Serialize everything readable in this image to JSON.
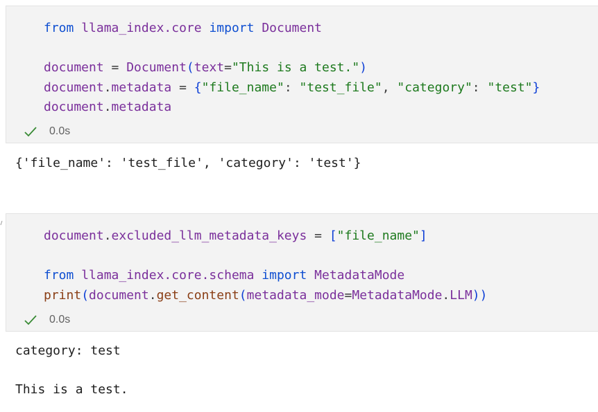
{
  "cells": [
    {
      "code_lines": [
        [
          {
            "t": "from",
            "c": "kw"
          },
          {
            "t": " ",
            "c": "plain"
          },
          {
            "t": "llama_index.core",
            "c": "var"
          },
          {
            "t": " ",
            "c": "plain"
          },
          {
            "t": "import",
            "c": "kw"
          },
          {
            "t": " ",
            "c": "plain"
          },
          {
            "t": "Document",
            "c": "var"
          }
        ],
        [],
        [
          {
            "t": "document",
            "c": "var"
          },
          {
            "t": " = ",
            "c": "plain"
          },
          {
            "t": "Document",
            "c": "var"
          },
          {
            "t": "(",
            "c": "br1"
          },
          {
            "t": "text",
            "c": "var"
          },
          {
            "t": "=",
            "c": "plain"
          },
          {
            "t": "\"This is a test.\"",
            "c": "str"
          },
          {
            "t": ")",
            "c": "br1"
          }
        ],
        [
          {
            "t": "document",
            "c": "var"
          },
          {
            "t": ".",
            "c": "plain"
          },
          {
            "t": "metadata",
            "c": "var"
          },
          {
            "t": " = ",
            "c": "plain"
          },
          {
            "t": "{",
            "c": "br1"
          },
          {
            "t": "\"file_name\"",
            "c": "str"
          },
          {
            "t": ": ",
            "c": "plain"
          },
          {
            "t": "\"test_file\"",
            "c": "str"
          },
          {
            "t": ", ",
            "c": "plain"
          },
          {
            "t": "\"category\"",
            "c": "str"
          },
          {
            "t": ": ",
            "c": "plain"
          },
          {
            "t": "\"test\"",
            "c": "str"
          },
          {
            "t": "}",
            "c": "br1"
          }
        ],
        [
          {
            "t": "document",
            "c": "var"
          },
          {
            "t": ".",
            "c": "plain"
          },
          {
            "t": "metadata",
            "c": "var"
          }
        ]
      ],
      "exec_time": "0.0s",
      "output_lines": [
        "{'file_name': 'test_file', 'category': 'test'}"
      ]
    },
    {
      "code_lines": [
        [
          {
            "t": "document",
            "c": "var"
          },
          {
            "t": ".",
            "c": "plain"
          },
          {
            "t": "excluded_llm_metadata_keys",
            "c": "var"
          },
          {
            "t": " = ",
            "c": "plain"
          },
          {
            "t": "[",
            "c": "br1"
          },
          {
            "t": "\"file_name\"",
            "c": "str"
          },
          {
            "t": "]",
            "c": "br1"
          }
        ],
        [],
        [
          {
            "t": "from",
            "c": "kw"
          },
          {
            "t": " ",
            "c": "plain"
          },
          {
            "t": "llama_index.core.schema",
            "c": "var"
          },
          {
            "t": " ",
            "c": "plain"
          },
          {
            "t": "import",
            "c": "kw"
          },
          {
            "t": " ",
            "c": "plain"
          },
          {
            "t": "MetadataMode",
            "c": "var"
          }
        ],
        [
          {
            "t": "print",
            "c": "fn"
          },
          {
            "t": "(",
            "c": "br1"
          },
          {
            "t": "document",
            "c": "var"
          },
          {
            "t": ".",
            "c": "plain"
          },
          {
            "t": "get_content",
            "c": "fn"
          },
          {
            "t": "(",
            "c": "br2"
          },
          {
            "t": "metadata_mode",
            "c": "var"
          },
          {
            "t": "=",
            "c": "plain"
          },
          {
            "t": "MetadataMode",
            "c": "var"
          },
          {
            "t": ".",
            "c": "plain"
          },
          {
            "t": "LLM",
            "c": "var"
          },
          {
            "t": "))",
            "c": "br1"
          }
        ]
      ],
      "exec_time": "0.0s",
      "output_lines": [
        "category: test",
        "",
        "This is a test."
      ]
    }
  ],
  "icons": {
    "status": "checkmark-icon"
  },
  "colors": {
    "keyword": "#0f4fd1",
    "variable": "#7a2f9b",
    "string": "#1e7a1e",
    "function": "#8a3e15",
    "bracket": "#0d3fd6",
    "check": "#388a34",
    "cell_bg": "#f3f3f3"
  }
}
